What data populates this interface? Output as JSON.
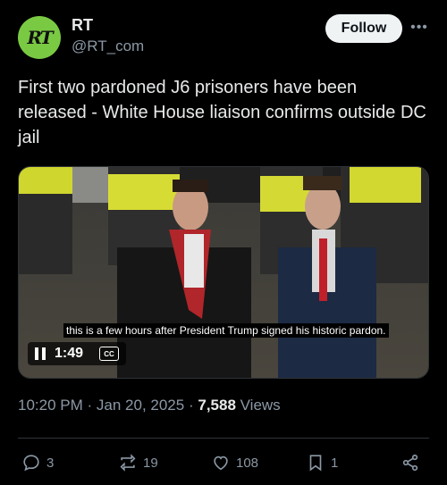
{
  "author": {
    "name": "RT",
    "handle": "@RT_com",
    "logo_text": "RT",
    "avatar_color": "#7ac943"
  },
  "follow_label": "Follow",
  "more_label": "•••",
  "tweet_text": "First two pardoned J6 prisoners have been released - White House liaison confirms outside DC jail",
  "video": {
    "caption": "this is a few hours after President Trump signed his historic pardon.",
    "time": "1:49",
    "cc_label": "CC"
  },
  "meta": {
    "time": "10:20 PM",
    "separator": "·",
    "date": "Jan 20, 2025",
    "views_count": "7,588",
    "views_label": "Views"
  },
  "actions": {
    "replies": "3",
    "reposts": "19",
    "likes": "108",
    "bookmarks": "1"
  },
  "icons": [
    "more-icon",
    "pause-icon",
    "cc-icon",
    "reply-icon",
    "repost-icon",
    "like-icon",
    "bookmark-icon",
    "share-icon"
  ],
  "colors": {
    "background": "#000000",
    "text": "#e7e9ea",
    "muted": "#8b98a5",
    "follow_bg": "#eff3f4"
  }
}
